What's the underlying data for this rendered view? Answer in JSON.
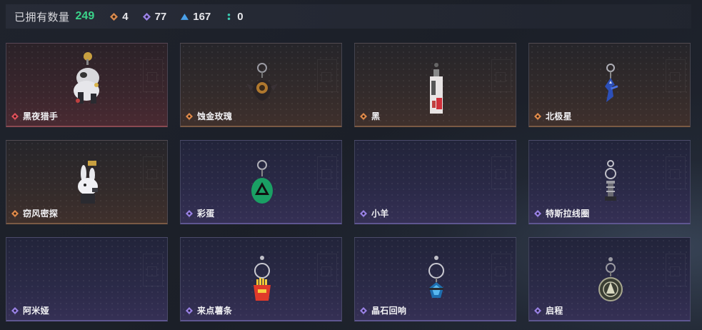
{
  "header": {
    "owned_label": "已拥有数量",
    "owned_total": "249",
    "stats": [
      {
        "icon": "orange-gem-icon",
        "color": "#d98a4e",
        "value": "4"
      },
      {
        "icon": "purple-gem-icon",
        "color": "#9a82e6",
        "value": "77"
      },
      {
        "icon": "blue-gem-icon",
        "color": "#4aa0e8",
        "value": "167"
      },
      {
        "icon": "teal-gem-icon",
        "color": "#3ac9b0",
        "value": "0"
      }
    ]
  },
  "items": [
    {
      "name": "黑夜猎手",
      "rarity": "red",
      "gem_color": "#e0505a",
      "art": "white-mech-creature"
    },
    {
      "name": "蚀金玫瑰",
      "rarity": "orange",
      "gem_color": "#e08a4a",
      "art": "dark-rose-keychain"
    },
    {
      "name": "黑",
      "rarity": "orange",
      "gem_color": "#e08a4a",
      "art": "card-keychain"
    },
    {
      "name": "北极星",
      "rarity": "orange",
      "gem_color": "#e08a4a",
      "art": "blue-star-keychain"
    },
    {
      "name": "窃风密探",
      "rarity": "orange",
      "gem_color": "#e08a4a",
      "art": "white-rabbit-figure"
    },
    {
      "name": "彩蛋",
      "rarity": "purple",
      "gem_color": "#9a82e6",
      "art": "green-egg-keychain"
    },
    {
      "name": "小羊",
      "rarity": "purple",
      "gem_color": "#9a82e6",
      "art": ""
    },
    {
      "name": "特斯拉线圈",
      "rarity": "purple",
      "gem_color": "#9a82e6",
      "art": "coil-keychain"
    },
    {
      "name": "阿米娅",
      "rarity": "purple",
      "gem_color": "#9a82e6",
      "art": ""
    },
    {
      "name": "来点薯条",
      "rarity": "purple",
      "gem_color": "#9a82e6",
      "art": "fries-keychain"
    },
    {
      "name": "晶石回响",
      "rarity": "purple",
      "gem_color": "#9a82e6",
      "art": "blue-crystal-keychain"
    },
    {
      "name": "启程",
      "rarity": "purple",
      "gem_color": "#9a82e6",
      "art": "medallion-keychain"
    }
  ]
}
